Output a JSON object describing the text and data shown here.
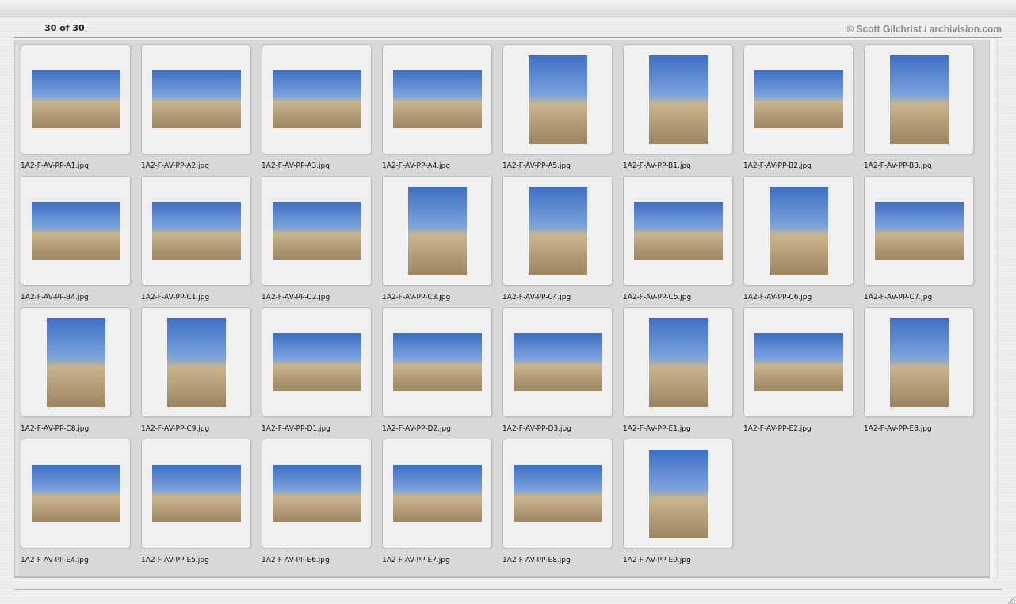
{
  "header": {
    "count": "30 of 30",
    "credit": "© Scott Gilchrist / archivision.com"
  },
  "thumbnails": [
    {
      "filename": "1A2-F-AV-PP-A1.jpg",
      "kind": "landscape"
    },
    {
      "filename": "1A2-F-AV-PP-A2.jpg",
      "kind": "landscape"
    },
    {
      "filename": "1A2-F-AV-PP-A3.jpg",
      "kind": "landscape"
    },
    {
      "filename": "1A2-F-AV-PP-A4.jpg",
      "kind": "landscape"
    },
    {
      "filename": "1A2-F-AV-PP-A5.jpg",
      "kind": "portrait"
    },
    {
      "filename": "1A2-F-AV-PP-B1.jpg",
      "kind": "portrait"
    },
    {
      "filename": "1A2-F-AV-PP-B2.jpg",
      "kind": "landscape"
    },
    {
      "filename": "1A2-F-AV-PP-B3.jpg",
      "kind": "portrait"
    },
    {
      "filename": "1A2-F-AV-PP-B4.jpg",
      "kind": "landscape"
    },
    {
      "filename": "1A2-F-AV-PP-C1.jpg",
      "kind": "landscape"
    },
    {
      "filename": "1A2-F-AV-PP-C2.jpg",
      "kind": "landscape"
    },
    {
      "filename": "1A2-F-AV-PP-C3.jpg",
      "kind": "portrait"
    },
    {
      "filename": "1A2-F-AV-PP-C4.jpg",
      "kind": "portrait"
    },
    {
      "filename": "1A2-F-AV-PP-C5.jpg",
      "kind": "landscape"
    },
    {
      "filename": "1A2-F-AV-PP-C6.jpg",
      "kind": "portrait"
    },
    {
      "filename": "1A2-F-AV-PP-C7.jpg",
      "kind": "landscape"
    },
    {
      "filename": "1A2-F-AV-PP-C8.jpg",
      "kind": "portrait"
    },
    {
      "filename": "1A2-F-AV-PP-C9.jpg",
      "kind": "portrait"
    },
    {
      "filename": "1A2-F-AV-PP-D1.jpg",
      "kind": "landscape"
    },
    {
      "filename": "1A2-F-AV-PP-D2.jpg",
      "kind": "landscape"
    },
    {
      "filename": "1A2-F-AV-PP-D3.jpg",
      "kind": "landscape"
    },
    {
      "filename": "1A2-F-AV-PP-E1.jpg",
      "kind": "portrait"
    },
    {
      "filename": "1A2-F-AV-PP-E2.jpg",
      "kind": "landscape"
    },
    {
      "filename": "1A2-F-AV-PP-E3.jpg",
      "kind": "portrait"
    },
    {
      "filename": "1A2-F-AV-PP-E4.jpg",
      "kind": "landscape"
    },
    {
      "filename": "1A2-F-AV-PP-E5.jpg",
      "kind": "landscape"
    },
    {
      "filename": "1A2-F-AV-PP-E6.jpg",
      "kind": "landscape"
    },
    {
      "filename": "1A2-F-AV-PP-E7.jpg",
      "kind": "landscape"
    },
    {
      "filename": "1A2-F-AV-PP-E8.jpg",
      "kind": "landscape"
    },
    {
      "filename": "1A2-F-AV-PP-E9.jpg",
      "kind": "portrait"
    }
  ]
}
